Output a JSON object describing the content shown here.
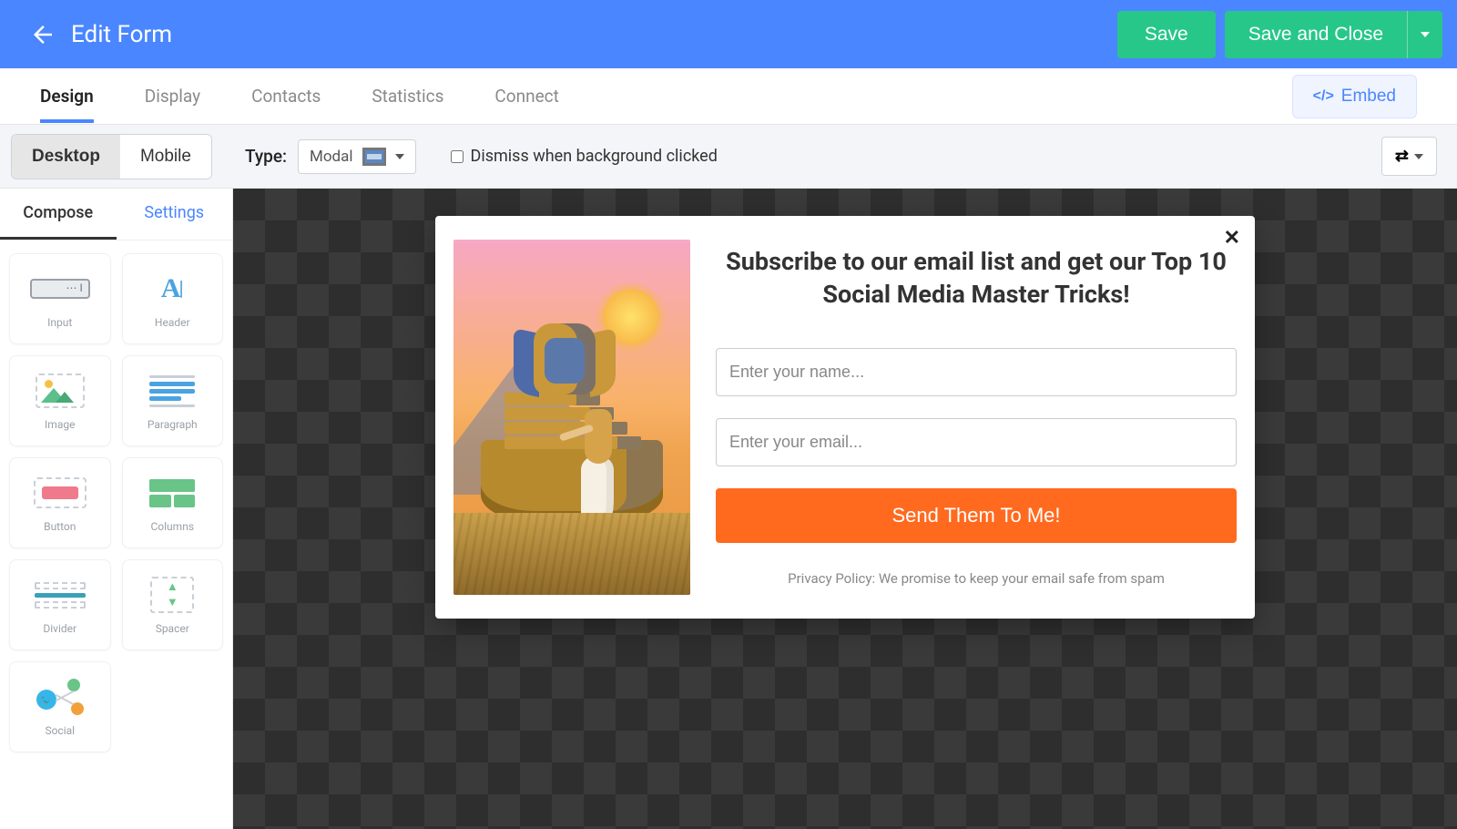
{
  "header": {
    "title": "Edit Form",
    "save_label": "Save",
    "save_close_label": "Save and Close"
  },
  "tabs": {
    "items": [
      "Design",
      "Display",
      "Contacts",
      "Statistics",
      "Connect"
    ],
    "active_index": 0,
    "embed_label": "Embed"
  },
  "toolbar": {
    "device": {
      "desktop": "Desktop",
      "mobile": "Mobile",
      "active": "desktop"
    },
    "type_label": "Type:",
    "type_value": "Modal",
    "dismiss_label": "Dismiss when background clicked",
    "dismiss_checked": false
  },
  "sidebar": {
    "compose_label": "Compose",
    "settings_label": "Settings",
    "components": [
      {
        "key": "input",
        "label": "Input"
      },
      {
        "key": "header",
        "label": "Header"
      },
      {
        "key": "image",
        "label": "Image"
      },
      {
        "key": "paragraph",
        "label": "Paragraph"
      },
      {
        "key": "button",
        "label": "Button"
      },
      {
        "key": "columns",
        "label": "Columns"
      },
      {
        "key": "divider",
        "label": "Divider"
      },
      {
        "key": "spacer",
        "label": "Spacer"
      },
      {
        "key": "social",
        "label": "Social"
      }
    ]
  },
  "form": {
    "heading": "Subscribe to our email list and get our Top 10 Social Media Master Tricks!",
    "name_placeholder": "Enter your name...",
    "email_placeholder": "Enter your email...",
    "submit_label": "Send Them To Me!",
    "privacy_text": "Privacy Policy: We promise to keep your email safe from spam",
    "close_symbol": "✕"
  }
}
